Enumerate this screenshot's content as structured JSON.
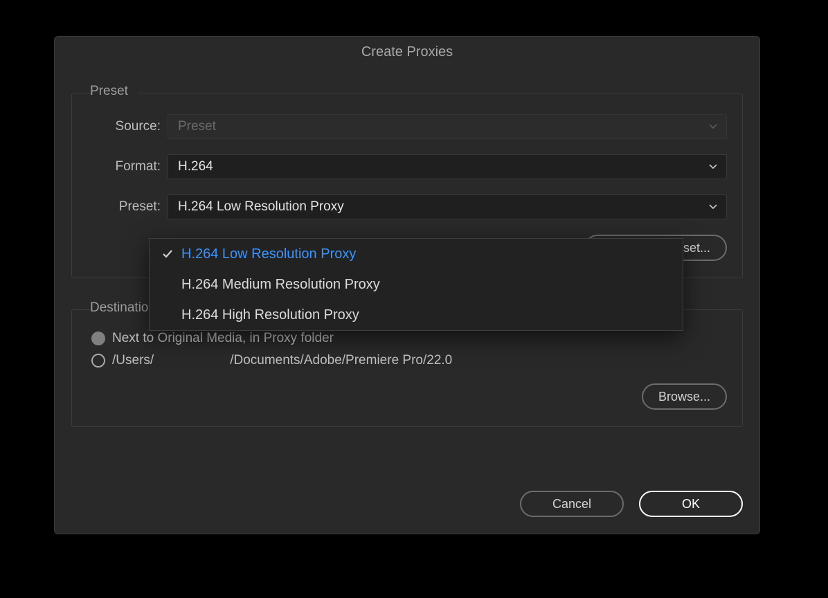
{
  "dialog": {
    "title": "Create Proxies",
    "preset_section": {
      "legend": "Preset",
      "source_label": "Source:",
      "source_value": "Preset",
      "format_label": "Format:",
      "format_value": "H.264",
      "preset_label": "Preset:",
      "preset_value": "H.264 Low Resolution Proxy",
      "add_ingest_preset": "Add Ingest Preset...",
      "dropdown": {
        "options": [
          "H.264 Low Resolution Proxy",
          "H.264 Medium Resolution Proxy",
          "H.264 High Resolution Proxy"
        ],
        "selected_index": 0
      }
    },
    "destination_section": {
      "legend": "Destination",
      "option1": "Next to Original Media, in Proxy folder",
      "option2_prefix": "/Users/",
      "option2_suffix": "/Documents/Adobe/Premiere Pro/22.0",
      "browse": "Browse..."
    },
    "buttons": {
      "cancel": "Cancel",
      "ok": "OK"
    }
  }
}
